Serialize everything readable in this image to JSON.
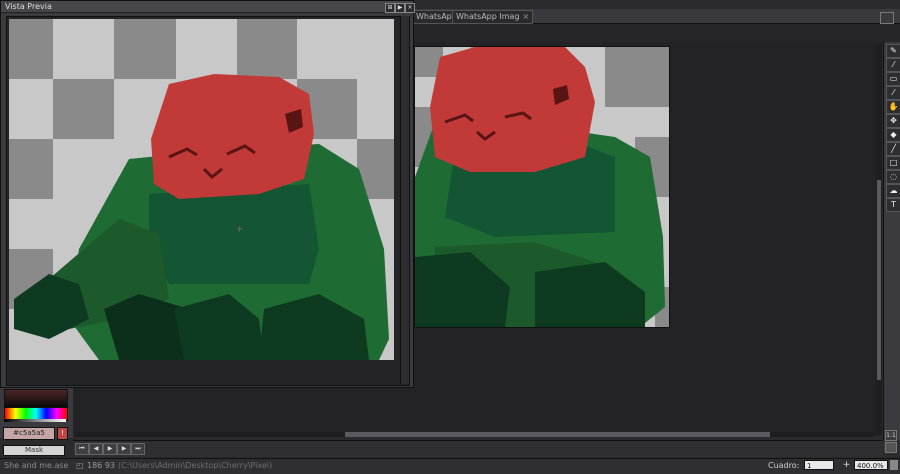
{
  "tabs": [
    {
      "label": "WhatsApp Imag"
    },
    {
      "label": "WhatsApp Imag"
    }
  ],
  "preview": {
    "title": "Vista Previa",
    "buttons": [
      "pin-icon",
      "play-icon",
      "close-icon"
    ]
  },
  "tools": [
    "pencil-icon",
    "brush-icon",
    "eraser-icon",
    "eyedropper-icon",
    "hand-icon",
    "move-icon",
    "fill-icon",
    "line-icon",
    "rectangle-icon",
    "lasso-icon",
    "smudge-icon",
    "text-icon"
  ],
  "tool_glyphs": [
    "✎",
    "⁄",
    "▭",
    "⁄",
    "✋",
    "✥",
    "◆",
    "╱",
    "□",
    "◌",
    "☁",
    "T"
  ],
  "color": {
    "hex": "#c5a5a5",
    "mask_label": "Mask",
    "accent": "#c5a5a5",
    "alert_label": "!"
  },
  "frame_controls": [
    "⏮",
    "◀",
    "▶",
    "▶",
    "⏭"
  ],
  "status": {
    "file": "She and me.ase",
    "coords": "186 93",
    "path": "(C:\\Users\\Admin\\Desktop\\Cherry\\Pixel)",
    "frame_label": "Cuadro:",
    "frame_value": "1",
    "zoom": "400.0%",
    "ratio": "1:1"
  }
}
